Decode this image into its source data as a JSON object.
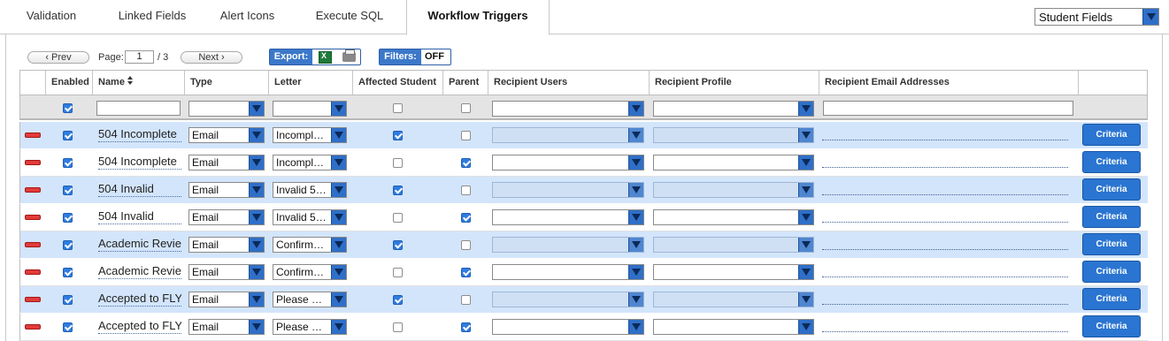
{
  "tabs": [
    {
      "label": "Validation",
      "active": false
    },
    {
      "label": "Linked Fields",
      "active": false
    },
    {
      "label": "Alert Icons",
      "active": false
    },
    {
      "label": "Execute SQL",
      "active": false
    },
    {
      "label": "Workflow Triggers",
      "active": true
    }
  ],
  "field_selector": {
    "value": "Student Fields"
  },
  "toolbar": {
    "prev_label": "‹ Prev",
    "next_label": "Next ›",
    "page_label": "Page:",
    "page_value": "1",
    "page_total": "/ 3",
    "export_label": "Export:",
    "filters_label": "Filters:",
    "filters_state": "OFF"
  },
  "columns": {
    "enabled": "Enabled",
    "name": "Name",
    "type": "Type",
    "letter": "Letter",
    "affected_student": "Affected Student",
    "parent": "Parent",
    "recipient_users": "Recipient Users",
    "recipient_profile": "Recipient Profile",
    "recipient_email": "Recipient Email Addresses"
  },
  "filter_row": {
    "enabled": true,
    "affected_student": false,
    "parent": false
  },
  "rows": [
    {
      "enabled": true,
      "name": "504 Incomplete",
      "type": "Email",
      "letter": "Incompl…",
      "affected_student": true,
      "parent": false,
      "criteria_label": "Criteria"
    },
    {
      "enabled": true,
      "name": "504 Incomplete",
      "type": "Email",
      "letter": "Incompl…",
      "affected_student": false,
      "parent": true,
      "criteria_label": "Criteria"
    },
    {
      "enabled": true,
      "name": "504 Invalid",
      "type": "Email",
      "letter": "Invalid 5…",
      "affected_student": true,
      "parent": false,
      "criteria_label": "Criteria"
    },
    {
      "enabled": true,
      "name": "504 Invalid",
      "type": "Email",
      "letter": "Invalid 5…",
      "affected_student": false,
      "parent": true,
      "criteria_label": "Criteria"
    },
    {
      "enabled": true,
      "name": "Academic Review",
      "type": "Email",
      "letter": "Confirm…",
      "affected_student": true,
      "parent": false,
      "criteria_label": "Criteria"
    },
    {
      "enabled": true,
      "name": "Academic Review",
      "type": "Email",
      "letter": "Confirm…",
      "affected_student": false,
      "parent": true,
      "criteria_label": "Criteria"
    },
    {
      "enabled": true,
      "name": "Accepted to FLY",
      "type": "Email",
      "letter": "Please …",
      "affected_student": true,
      "parent": false,
      "criteria_label": "Criteria"
    },
    {
      "enabled": true,
      "name": "Accepted to FLY",
      "type": "Email",
      "letter": "Please …",
      "affected_student": false,
      "parent": true,
      "criteria_label": "Criteria"
    }
  ],
  "icons": [
    "excel-icon",
    "print-icon",
    "sort-icon",
    "remove-row-icon",
    "dropdown-arrow-icon"
  ],
  "colors": {
    "accent": "#2f6fc8",
    "row_alt": "#d3e5fb",
    "remove": "#e23b3b",
    "button": "#2a75d1"
  }
}
